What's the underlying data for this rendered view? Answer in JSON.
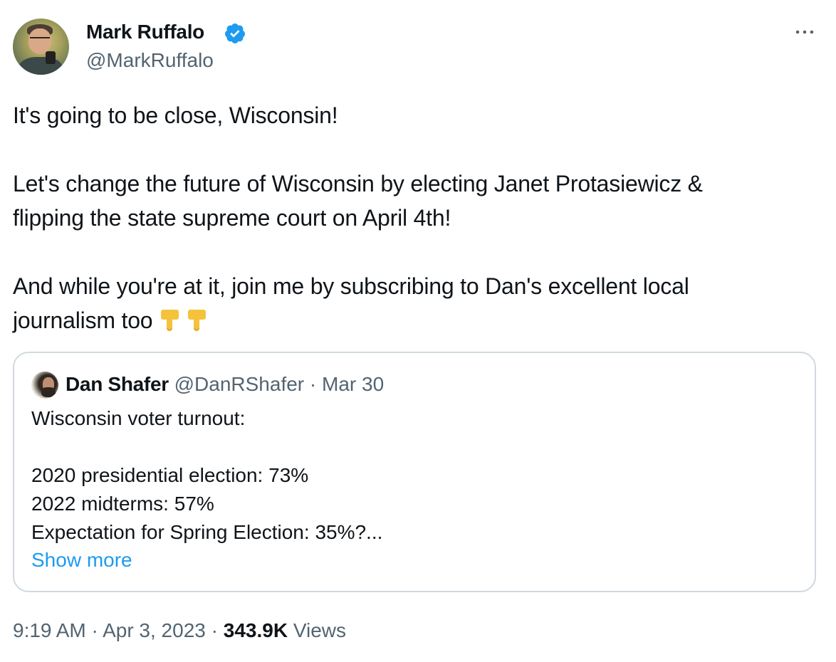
{
  "author": {
    "display_name": "Mark Ruffalo",
    "handle": "@MarkRuffalo",
    "verified_icon": "verified-badge-icon",
    "verified_color": "#1d9bf0"
  },
  "more_icon": "more-horizontal-icon",
  "tweet": {
    "text": "It's going to be close, Wisconsin!\n\nLet's change the future of Wisconsin by electing Janet Protasiewicz &\nflipping the state supreme court on April 4th!\n\nAnd while you're at it, join me by subscribing to Dan's excellent local\njournalism too",
    "emojis": [
      "👇",
      "👇"
    ]
  },
  "quote": {
    "display_name": "Dan Shafer",
    "handle": "@DanRShafer",
    "separator": "·",
    "date": "Mar 30",
    "text": "Wisconsin voter turnout:\n\n2020 presidential election: 73%\n2022 midterms: 57%\nExpectation for Spring Election: 35%?...",
    "show_more": "Show more",
    "link_color": "#1d9bf0"
  },
  "footer": {
    "time": "9:19 AM",
    "separator": "·",
    "date": "Apr 3, 2023",
    "views_count": "343.9K",
    "views_label": "Views"
  },
  "colors": {
    "text_primary": "#0f1419",
    "text_secondary": "#536471",
    "border": "#cfd9de",
    "emoji": "#f5c33b"
  }
}
